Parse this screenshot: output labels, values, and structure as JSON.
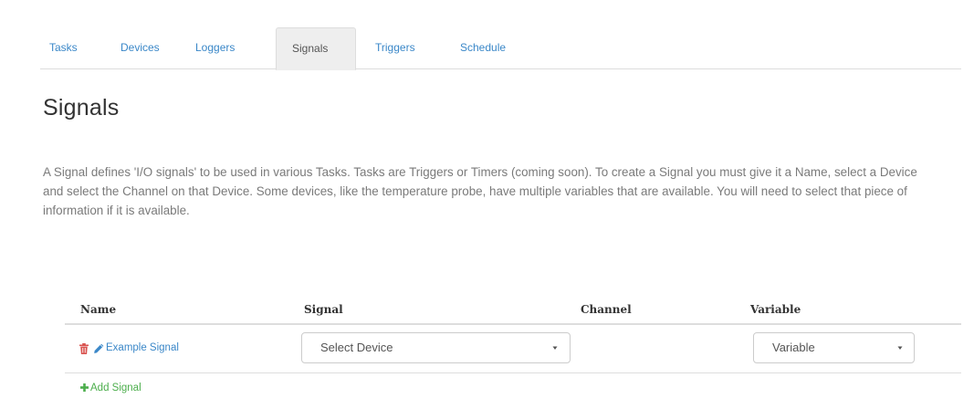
{
  "tabs": [
    {
      "label": "Tasks",
      "active": false
    },
    {
      "label": "Devices",
      "active": false
    },
    {
      "label": "Loggers",
      "active": false
    },
    {
      "label": "Signals",
      "active": true
    },
    {
      "label": "Triggers",
      "active": false
    },
    {
      "label": "Schedule",
      "active": false
    }
  ],
  "page": {
    "title": "Signals",
    "description": "A Signal defines 'I/O signals' to be used in various Tasks. Tasks are Triggers or Timers (coming soon). To create a Signal you must give it a Name, select a Device and select the Channel on that Device. Some devices, like the temperature probe, have multiple variables that are available. You will need to select that piece of information if it is available."
  },
  "table": {
    "headers": {
      "name": "Name",
      "signal": "Signal",
      "channel": "Channel",
      "variable": "Variable"
    },
    "rows": [
      {
        "name": "Example Signal",
        "signal_select": "Select Device",
        "channel": "",
        "variable_select": "Variable"
      }
    ]
  },
  "actions": {
    "add_signal": "Add Signal"
  },
  "icons": {
    "delete": "trash-icon",
    "edit": "pencil-icon",
    "add": "plus-icon",
    "dropdown": "caret-down-icon"
  },
  "colors": {
    "link": "#3a87c8",
    "delete": "#d9534f",
    "add": "#4cae4c",
    "active_tab_bg": "#eeeeee"
  }
}
